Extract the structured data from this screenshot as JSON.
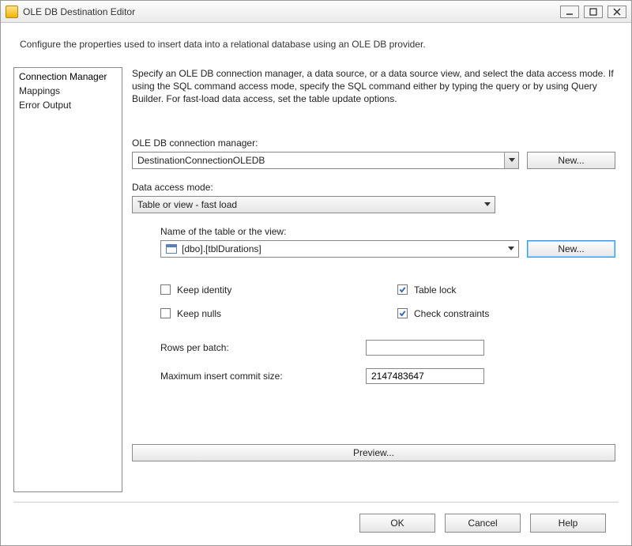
{
  "window": {
    "title": "OLE DB Destination Editor"
  },
  "description": "Configure the properties used to insert data into a relational database using an OLE DB provider.",
  "nav": {
    "items": [
      "Connection Manager",
      "Mappings",
      "Error Output"
    ],
    "selectedIndex": 0
  },
  "panel": {
    "intro": "Specify an OLE DB connection manager, a data source, or a data source view, and select the data access mode. If using the SQL command access mode, specify the SQL command either by typing the query or by using Query Builder. For fast-load data access, set the table update options.",
    "connManagerLabel": "OLE DB connection manager:",
    "connManagerValue": "DestinationConnectionOLEDB",
    "newLabel": "New...",
    "accessModeLabel": "Data access mode:",
    "accessModeValue": "Table or view - fast load",
    "tableNameLabel": "Name of the table or the view:",
    "tableNameValue": "[dbo].[tblDurations]",
    "checkboxes": {
      "keepIdentity": {
        "label": "Keep identity",
        "checked": false
      },
      "tableLock": {
        "label": "Table lock",
        "checked": true
      },
      "keepNulls": {
        "label": "Keep nulls",
        "checked": false
      },
      "checkConstraints": {
        "label": "Check constraints",
        "checked": true
      }
    },
    "rowsPerBatchLabel": "Rows per batch:",
    "rowsPerBatchValue": "",
    "maxCommitLabel": "Maximum insert commit size:",
    "maxCommitValue": "2147483647",
    "previewLabel": "Preview..."
  },
  "footer": {
    "ok": "OK",
    "cancel": "Cancel",
    "help": "Help"
  }
}
